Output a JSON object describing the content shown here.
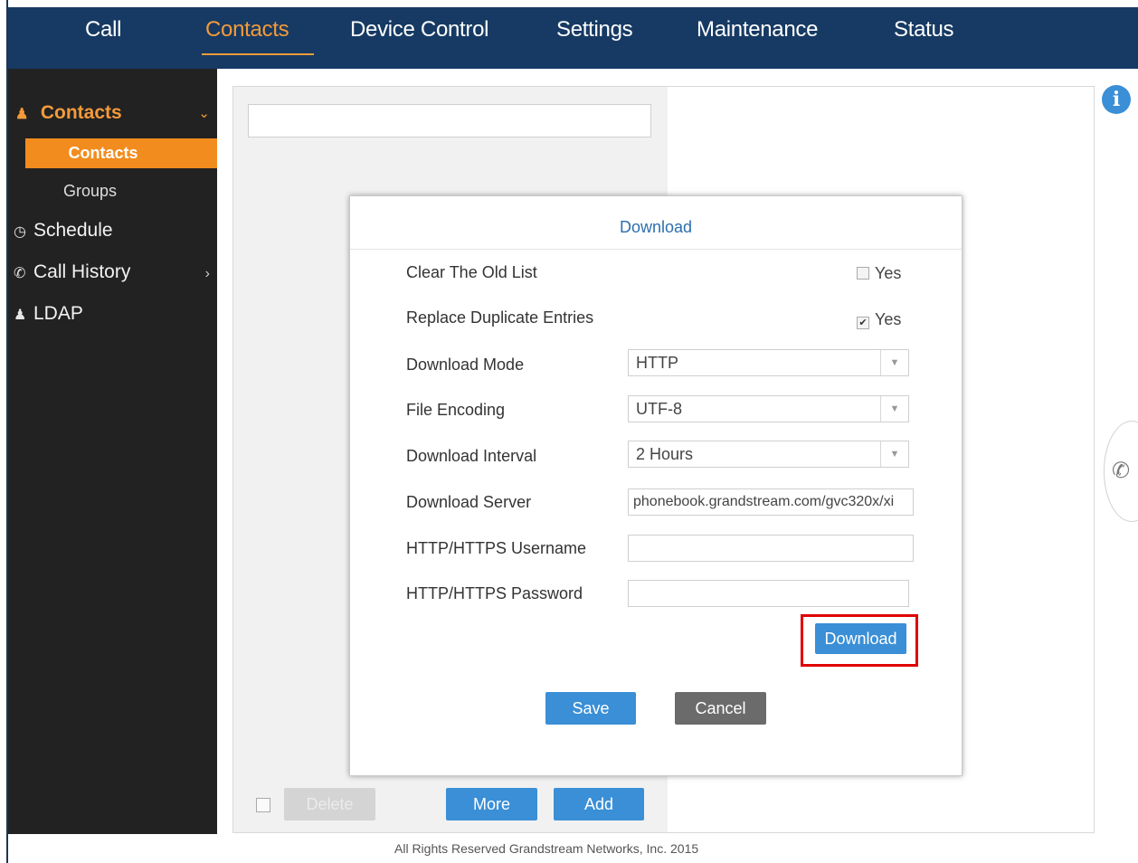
{
  "nav": {
    "tabs": [
      "Call",
      "Contacts",
      "Device Control",
      "Settings",
      "Maintenance",
      "Status"
    ],
    "active": "Contacts"
  },
  "sidebar": {
    "contacts": "Contacts",
    "contacts_sub": "Contacts",
    "groups": "Groups",
    "schedule": "Schedule",
    "call_history": "Call History",
    "ldap": "LDAP"
  },
  "list_panel": {
    "delete_label": "Delete",
    "more_label": "More",
    "add_label": "Add"
  },
  "dialog": {
    "title": "Download",
    "clear_old_list": {
      "label": "Clear The Old List",
      "option": "Yes",
      "checked": false
    },
    "replace_duplicates": {
      "label": "Replace Duplicate Entries",
      "option": "Yes",
      "checked": true
    },
    "download_mode": {
      "label": "Download Mode",
      "value": "HTTP"
    },
    "file_encoding": {
      "label": "File Encoding",
      "value": "UTF-8"
    },
    "download_interval": {
      "label": "Download Interval",
      "value": "2 Hours"
    },
    "download_server": {
      "label": "Download Server",
      "value": "phonebook.grandstream.com/gvc320x/xi"
    },
    "username": {
      "label": "HTTP/HTTPS Username",
      "value": ""
    },
    "password": {
      "label": "HTTP/HTTPS Password",
      "value": ""
    },
    "download_button": "Download",
    "save_button": "Save",
    "cancel_button": "Cancel"
  },
  "footer": "All Rights Reserved Grandstream Networks, Inc. 2015",
  "colors": {
    "nav_bg": "#163a63",
    "accent": "#f28c1e",
    "button_blue": "#3a8fd6",
    "highlight": "#e00000"
  }
}
